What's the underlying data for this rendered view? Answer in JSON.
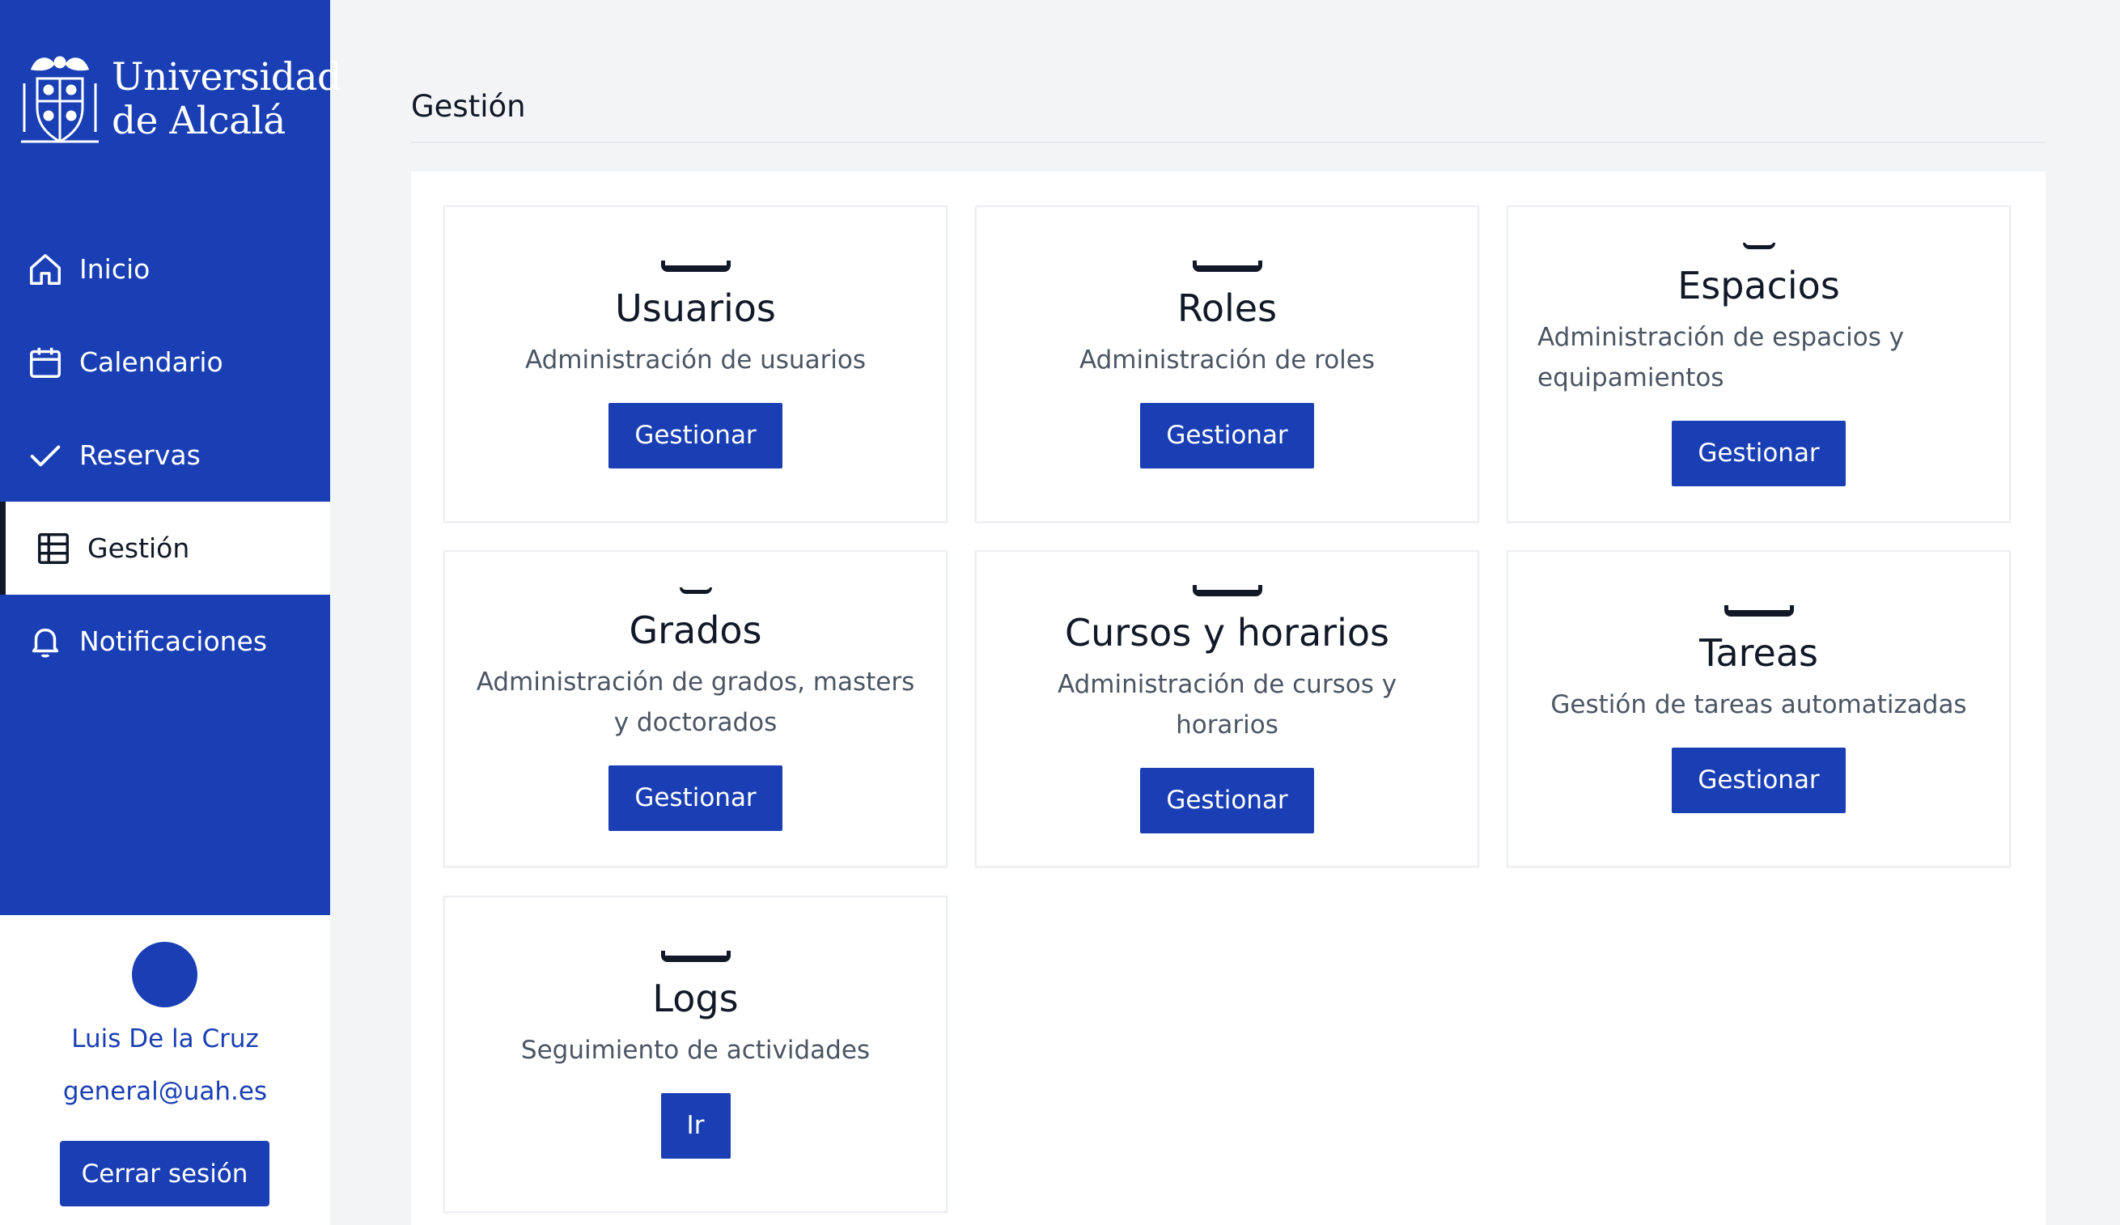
{
  "brand": {
    "line1": "Universidad",
    "line2": "de Alcalá",
    "color": "#1a3fb4"
  },
  "nav": {
    "items": [
      {
        "label": "Inicio",
        "icon": "home-icon"
      },
      {
        "label": "Calendario",
        "icon": "calendar-icon"
      },
      {
        "label": "Reservas",
        "icon": "check-icon"
      },
      {
        "label": "Gestión",
        "icon": "table-grid-icon",
        "active": true
      },
      {
        "label": "Notificaciones",
        "icon": "bell-icon"
      }
    ]
  },
  "user": {
    "name": "Luis De la Cruz",
    "email": "general@uah.es",
    "logout_label": "Cerrar sesión"
  },
  "page": {
    "title": "Gestión"
  },
  "cards": [
    {
      "title": "Usuarios",
      "description": "Administración de usuarios",
      "button": "Gestionar"
    },
    {
      "title": "Roles",
      "description": "Administración de roles",
      "button": "Gestionar"
    },
    {
      "title": "Espacios",
      "description": "Administración de espacios y equipamientos",
      "button": "Gestionar"
    },
    {
      "title": "Grados",
      "description": "Administración de grados, masters y doctorados",
      "button": "Gestionar"
    },
    {
      "title": "Cursos y horarios",
      "description": "Administración de cursos y horarios",
      "button": "Gestionar"
    },
    {
      "title": "Tareas",
      "description": "Gestión de tareas automatizadas",
      "button": "Gestionar"
    },
    {
      "title": "Logs",
      "description": "Seguimiento de actividades",
      "button": "Ir"
    }
  ]
}
